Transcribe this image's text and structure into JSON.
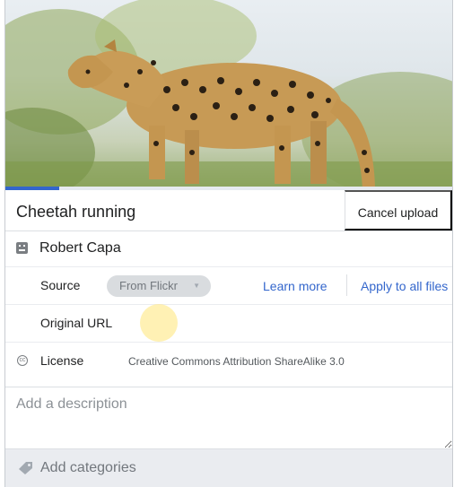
{
  "upload": {
    "title": "Cheetah running",
    "cancel_label": "Cancel upload",
    "progress_fraction": 0.12
  },
  "author": {
    "name": "Robert Capa",
    "icon": "author-icon"
  },
  "source": {
    "label": "Source",
    "value": "From Flickr",
    "learn_more": "Learn more",
    "apply_all": "Apply to all files"
  },
  "original_url": {
    "label": "Original URL",
    "value": ""
  },
  "license": {
    "label": "License",
    "value": "Creative Commons Attribution ShareAlike 3.0",
    "icon": "license-icon",
    "icon_glyph": "cc"
  },
  "description": {
    "placeholder": "Add a description",
    "value": ""
  },
  "categories": {
    "placeholder": "Add categories",
    "icon": "tag-icon"
  },
  "colors": {
    "accent": "#3366cc",
    "progress": "#3366cc",
    "pill_bg": "#d9dcdf",
    "footer_bg": "#eaecf0",
    "cursor_highlight": "#ffe98c"
  }
}
